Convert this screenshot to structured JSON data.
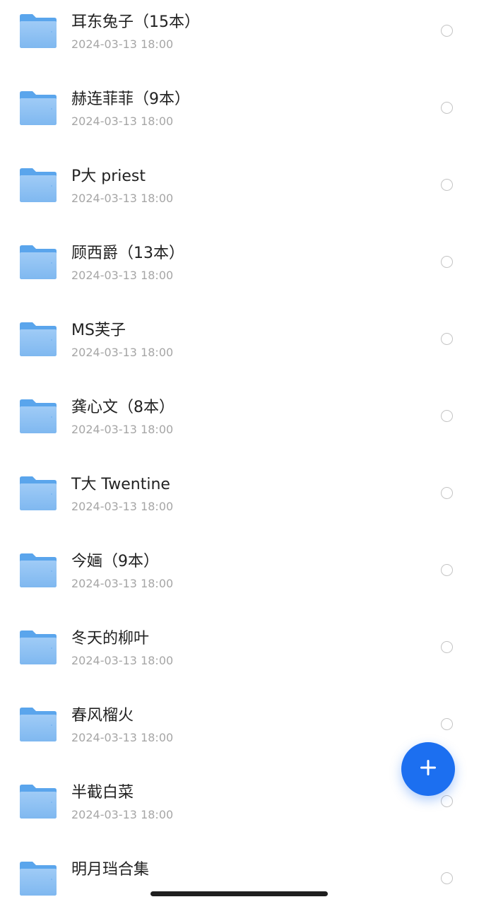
{
  "folders": [
    {
      "name": "耳东兔子（15本）",
      "date": "2024-03-13 18:00"
    },
    {
      "name": "赫连菲菲（9本）",
      "date": "2024-03-13 18:00"
    },
    {
      "name": "P大 priest",
      "date": "2024-03-13 18:00"
    },
    {
      "name": "顾西爵（13本）",
      "date": "2024-03-13 18:00"
    },
    {
      "name": "MS芙子",
      "date": "2024-03-13 18:00"
    },
    {
      "name": "龚心文（8本）",
      "date": "2024-03-13 18:00"
    },
    {
      "name": "T大 Twentine",
      "date": "2024-03-13 18:00"
    },
    {
      "name": "今婳（9本）",
      "date": "2024-03-13 18:00"
    },
    {
      "name": "冬天的柳叶",
      "date": "2024-03-13 18:00"
    },
    {
      "name": "春风榴火",
      "date": "2024-03-13 18:00"
    },
    {
      "name": "半截白菜",
      "date": "2024-03-13 18:00"
    },
    {
      "name": "明月珰合集",
      "date": ""
    }
  ],
  "icons": {
    "folder": "folder-icon",
    "select": "radio-circle",
    "fab": "plus-icon"
  },
  "colors": {
    "accent": "#1c6ff0",
    "folder_back": "#5aa5ec",
    "folder_front": "#8dc1f3",
    "title_text": "#222222",
    "date_text": "#a6a6a6"
  }
}
